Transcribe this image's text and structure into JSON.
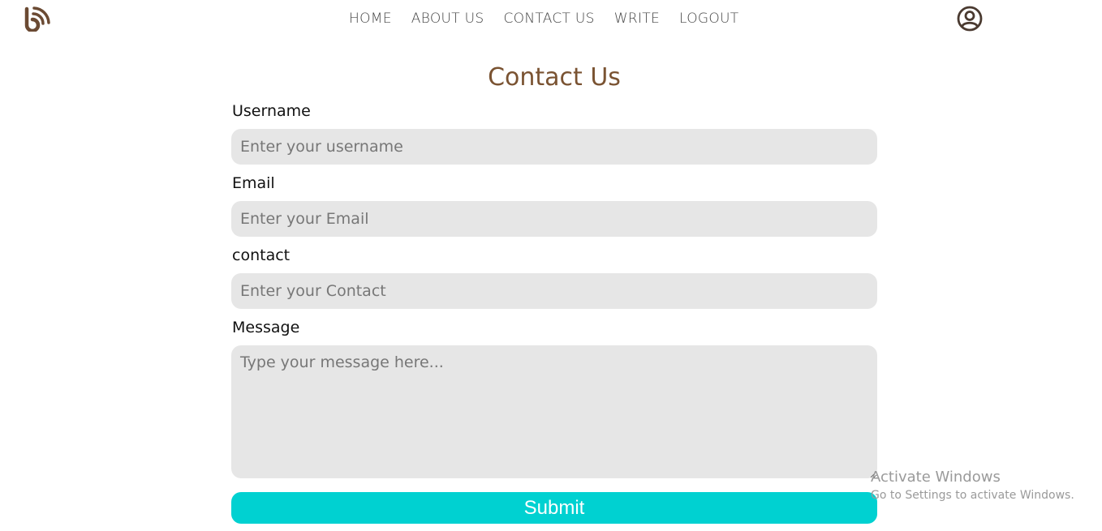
{
  "nav": {
    "items": [
      {
        "label": "HOME"
      },
      {
        "label": "ABOUT US"
      },
      {
        "label": "CONTACT US"
      },
      {
        "label": "WRITE"
      },
      {
        "label": "LOGOUT"
      }
    ]
  },
  "icons": {
    "logo": "blog-rss-logo-icon",
    "avatar": "user-circle-icon"
  },
  "colors": {
    "brand": "#7a5332",
    "submit_bg": "#00d1d1",
    "input_bg": "#e6e6e6"
  },
  "page": {
    "title": "Contact Us"
  },
  "form": {
    "username": {
      "label": "Username",
      "placeholder": "Enter your username"
    },
    "email": {
      "label": "Email",
      "placeholder": "Enter your Email"
    },
    "contact": {
      "label": "contact",
      "placeholder": "Enter your Contact"
    },
    "message": {
      "label": "Message",
      "placeholder": "Type your message here..."
    },
    "submit_label": "Submit"
  },
  "watermark": {
    "title": "Activate Windows",
    "subtitle": "Go to Settings to activate Windows."
  }
}
